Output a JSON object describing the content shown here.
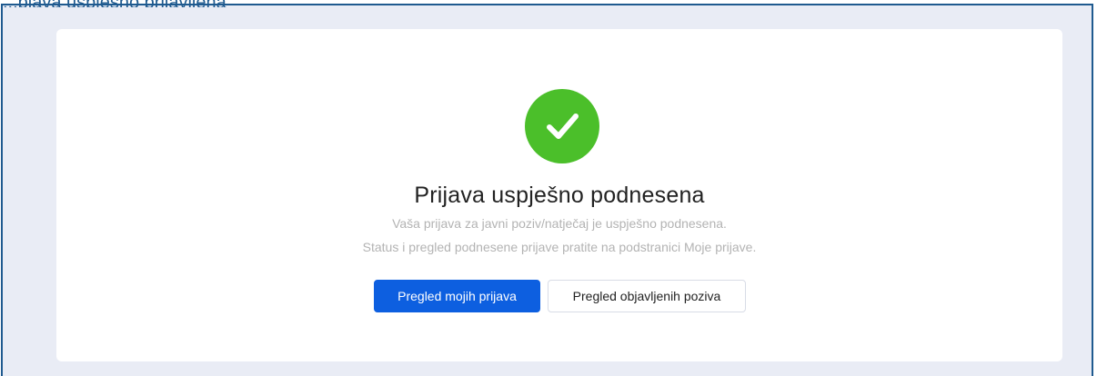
{
  "header": {
    "cut_title": "...pjava uspješno prijavljena"
  },
  "success": {
    "icon": "check-icon",
    "title": "Prijava uspješno podnesena",
    "message_line1": "Vaša prijava za javni poziv/natječaj je uspješno podnesena.",
    "message_line2": "Status i pregled podnesene prijave pratite na podstranici Moje prijave."
  },
  "actions": {
    "primary_label": "Pregled mojih prijava",
    "secondary_label": "Pregled objavljenih poziva"
  },
  "colors": {
    "frame_border": "#1f5a8f",
    "background": "#e9ecf5",
    "success_green": "#4bbf2a",
    "primary_blue": "#0d5fe0"
  }
}
